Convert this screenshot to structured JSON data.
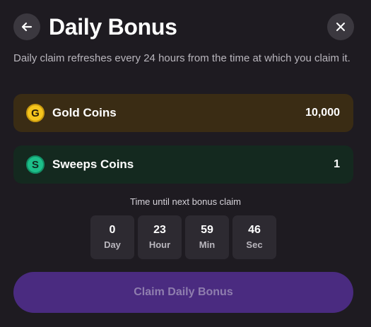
{
  "header": {
    "back_icon": "arrow-left-icon",
    "title": "Daily Bonus",
    "close_icon": "close-icon"
  },
  "description": "Daily claim refreshes every 24 hours from the time at which you claim it.",
  "coins": [
    {
      "icon": "G",
      "label": "Gold Coins",
      "value": "10,000",
      "color": "#f5c51d"
    },
    {
      "icon": "S",
      "label": "Sweeps Coins",
      "value": "1",
      "color": "#1dbf8a"
    }
  ],
  "timer": {
    "label": "Time until next bonus claim",
    "cells": [
      {
        "value": "0",
        "unit": "Day"
      },
      {
        "value": "23",
        "unit": "Hour"
      },
      {
        "value": "59",
        "unit": "Min"
      },
      {
        "value": "46",
        "unit": "Sec"
      }
    ]
  },
  "claim_button": {
    "label": "Claim Daily Bonus",
    "state": "disabled"
  },
  "colors": {
    "background": "#1e1b21",
    "gold_row": "#3a2c14",
    "sweeps_row": "#14291f",
    "claim_button": "#4a2b80"
  }
}
